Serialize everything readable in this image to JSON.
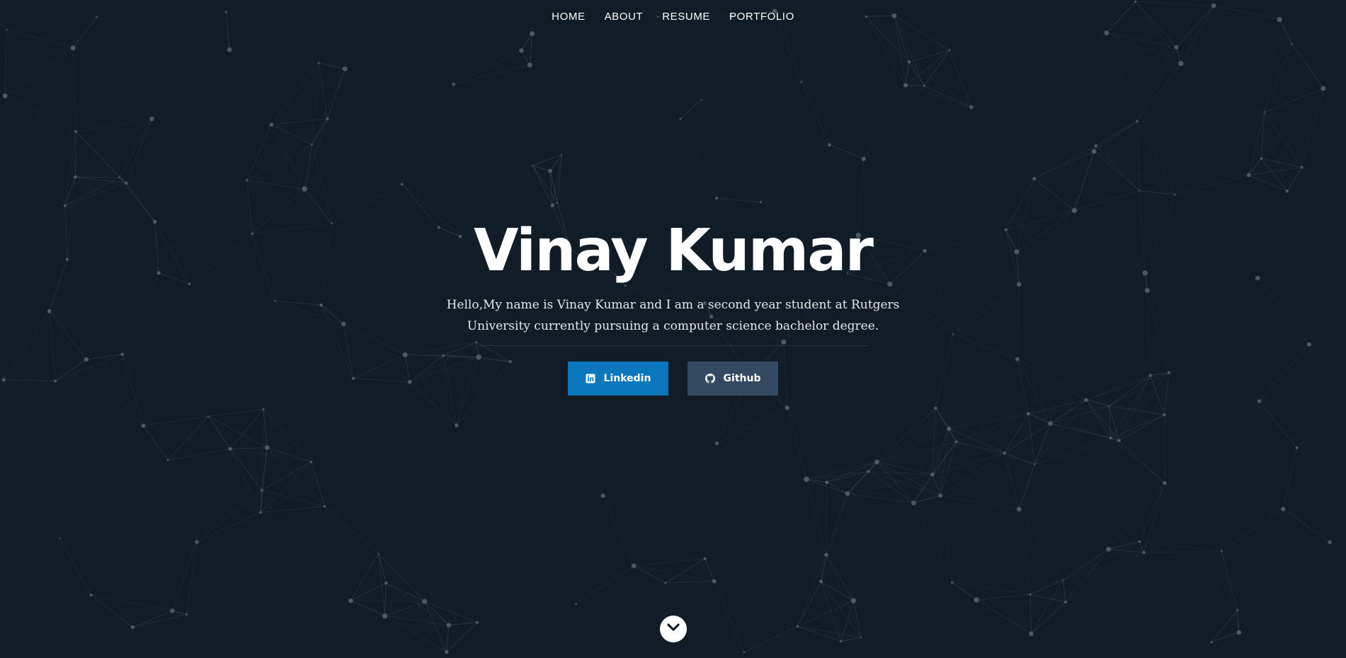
{
  "nav": {
    "items": [
      {
        "label": "HOME"
      },
      {
        "label": "ABOUT"
      },
      {
        "label": "RESUME"
      },
      {
        "label": "PORTFOLIO"
      }
    ]
  },
  "hero": {
    "name": "Vinay Kumar",
    "intro": "Hello,My name is Vinay Kumar and I am a second year student at Rutgers University currently pursuing a computer science bachelor degree."
  },
  "buttons": {
    "linkedin": {
      "label": "Linkedin",
      "icon": "linkedin-icon",
      "color": "#0b77bd"
    },
    "github": {
      "label": "Github",
      "icon": "github-icon",
      "color": "#344a63"
    }
  },
  "scroll": {
    "icon": "chevron-down-icon"
  },
  "colors": {
    "background": "#111c26",
    "particles": "#56606b"
  }
}
